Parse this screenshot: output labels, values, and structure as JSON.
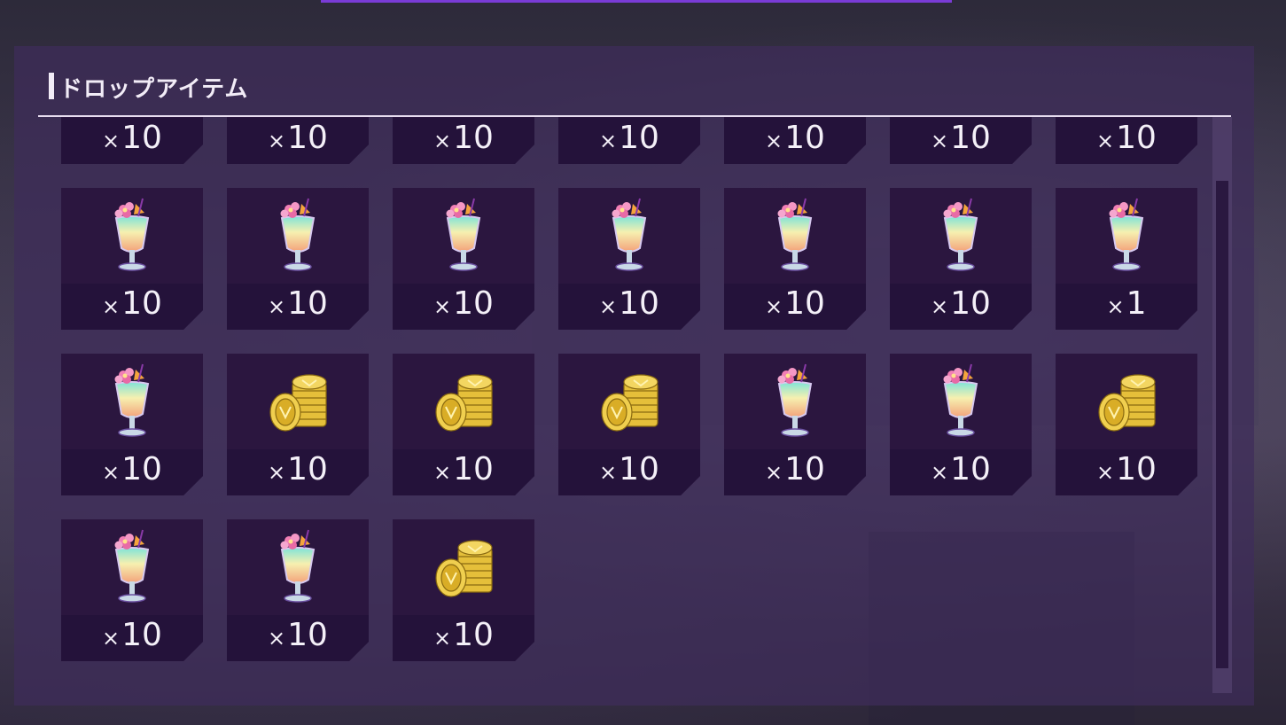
{
  "panel": {
    "title": "ドロップアイテム"
  },
  "items": [
    {
      "icon": "coin-stack-icon",
      "count": "10"
    },
    {
      "icon": "tropical-drink-icon",
      "count": "10"
    },
    {
      "icon": "tropical-drink-icon",
      "count": "10"
    },
    {
      "icon": "coin-stack-icon",
      "count": "10"
    },
    {
      "icon": "tropical-drink-icon",
      "count": "10"
    },
    {
      "icon": "tropical-drink-icon",
      "count": "10"
    },
    {
      "icon": "tropical-drink-icon",
      "count": "10"
    },
    {
      "icon": "tropical-drink-icon",
      "count": "10"
    },
    {
      "icon": "tropical-drink-icon",
      "count": "10"
    },
    {
      "icon": "tropical-drink-icon",
      "count": "10"
    },
    {
      "icon": "tropical-drink-icon",
      "count": "10"
    },
    {
      "icon": "tropical-drink-icon",
      "count": "10"
    },
    {
      "icon": "tropical-drink-icon",
      "count": "10"
    },
    {
      "icon": "tropical-drink-icon",
      "count": "1"
    },
    {
      "icon": "tropical-drink-icon",
      "count": "10"
    },
    {
      "icon": "coin-stack-icon",
      "count": "10"
    },
    {
      "icon": "coin-stack-icon",
      "count": "10"
    },
    {
      "icon": "coin-stack-icon",
      "count": "10"
    },
    {
      "icon": "tropical-drink-icon",
      "count": "10"
    },
    {
      "icon": "tropical-drink-icon",
      "count": "10"
    },
    {
      "icon": "coin-stack-icon",
      "count": "10"
    },
    {
      "icon": "tropical-drink-icon",
      "count": "10"
    },
    {
      "icon": "tropical-drink-icon",
      "count": "10"
    },
    {
      "icon": "coin-stack-icon",
      "count": "10"
    }
  ],
  "count_prefix": "×",
  "colors": {
    "accent": "#7a3bd6",
    "card": "#2b163f",
    "text": "#f4f0f8"
  }
}
